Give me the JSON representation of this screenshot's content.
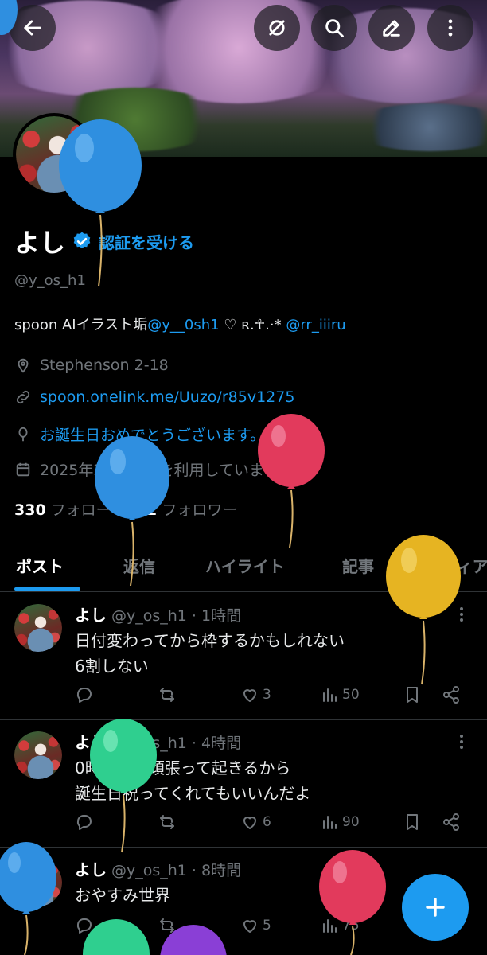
{
  "profile": {
    "display_name": "よし",
    "get_verified_label": "認証を受ける",
    "handle": "@y_os_h1",
    "bio_prefix": "spoon  AIイラスト垢",
    "bio_mention1": "@y__0sh1",
    "bio_middle": " ♡ ʀ.☥.·* ",
    "bio_mention2": "@rr_iiiru",
    "location": "Stephenson 2-18",
    "website": "spoon.onelink.me/Uuzo/r85v1275",
    "birthday": "お誕生日おめでとうございます。",
    "joined": "2025年2月からXを利用しています",
    "following_count": "330",
    "following_label": "フォロー",
    "followers_count": "302",
    "followers_label": "フォロワー"
  },
  "tabs": [
    {
      "label": "ポスト",
      "active": true
    },
    {
      "label": "返信",
      "active": false
    },
    {
      "label": "ハイライト",
      "active": false
    },
    {
      "label": "記事",
      "active": false
    },
    {
      "label": "メディア",
      "active": false
    }
  ],
  "posts": [
    {
      "name": "よし",
      "handle": "@y_os_h1",
      "time": "· 1時間",
      "text": "日付変わってから枠するかもしれない\n6割しない",
      "replies": "",
      "reposts": "",
      "likes": "3",
      "views": "50"
    },
    {
      "name": "よし",
      "handle": "@y_os_h1",
      "time": "· 4時間",
      "text": "0時までは頑張って起きるから\n誕生日祝ってくれてもいいんだよ",
      "replies": "",
      "reposts": "",
      "likes": "6",
      "views": "90"
    },
    {
      "name": "よし",
      "handle": "@y_os_h1",
      "time": "· 8時間",
      "text": "おやすみ世界",
      "replies": "",
      "reposts": "",
      "likes": "5",
      "views": "75"
    }
  ],
  "icons": {
    "back": "arrow-left-icon",
    "hide": "eye-off-icon",
    "search": "search-icon",
    "edit": "pencil-icon",
    "more": "more-vertical-icon",
    "compose": "plus-icon"
  },
  "colors": {
    "accent": "#1d9bf0",
    "background": "#000000",
    "muted": "#71767b"
  }
}
